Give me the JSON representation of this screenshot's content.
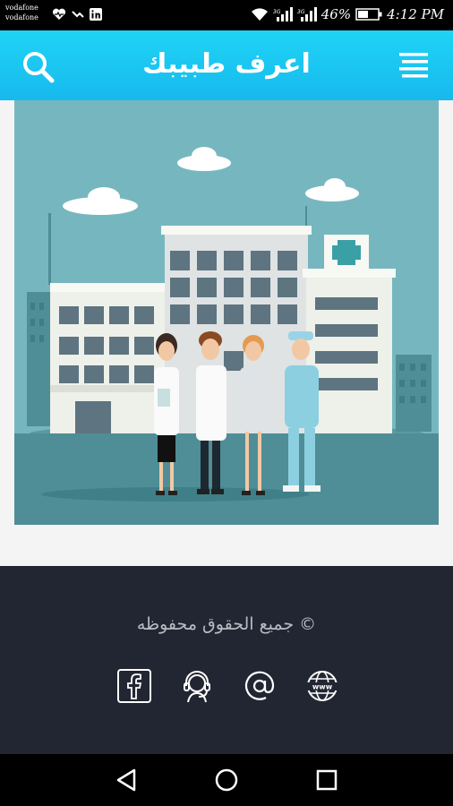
{
  "status_bar": {
    "carrier_1": "vodafone",
    "carrier_2": "vodafone",
    "battery": "46%",
    "time": "4:12 PM"
  },
  "app_bar": {
    "title": "اعرف طبيبك",
    "search_icon": "search-icon",
    "menu_icon": "menu-icon",
    "color": "#1fc8f2"
  },
  "hero": {
    "illustration": "hospital-with-doctors-and-nurses"
  },
  "footer": {
    "copyright": "© جميع الحقوق محفوظه",
    "social_links": [
      {
        "icon": "facebook-icon"
      },
      {
        "icon": "support-headset-icon"
      },
      {
        "icon": "email-at-icon"
      },
      {
        "icon": "globe-web-icon"
      }
    ]
  },
  "nav_bar": {
    "back": "back-icon",
    "home": "home-icon",
    "recents": "recents-icon"
  }
}
